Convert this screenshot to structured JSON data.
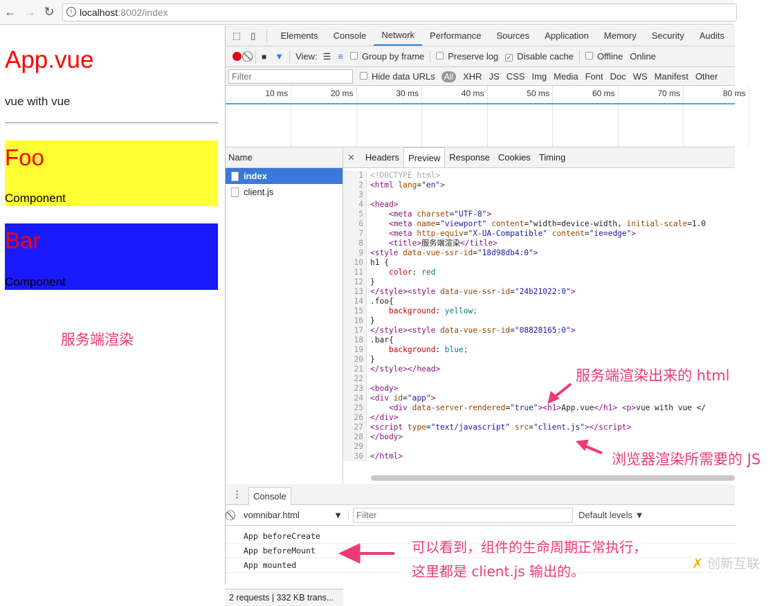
{
  "browser": {
    "url_host": "localhost",
    "url_path": ":8002/index"
  },
  "page": {
    "title": "App.vue",
    "text": "vue with vue",
    "foo": {
      "heading": "Foo",
      "text": "Component"
    },
    "bar": {
      "heading": "Bar",
      "text": "Component"
    },
    "annotation": "服务端渲染"
  },
  "devtools": {
    "tabs": [
      "Elements",
      "Console",
      "Network",
      "Performance",
      "Sources",
      "Application",
      "Memory",
      "Security",
      "Audits"
    ],
    "active_tab": "Network",
    "toolbar": {
      "view_label": "View:",
      "group_by_frame": "Group by frame",
      "preserve_log": "Preserve log",
      "disable_cache": "Disable cache",
      "disable_cache_checked": true,
      "offline": "Offline",
      "online": "Online"
    },
    "filter": {
      "placeholder": "Filter",
      "hide_data_urls": "Hide data URLs",
      "types": [
        "All",
        "XHR",
        "JS",
        "CSS",
        "Img",
        "Media",
        "Font",
        "Doc",
        "WS",
        "Manifest",
        "Other"
      ]
    },
    "timeline_ticks": [
      "10 ms",
      "20 ms",
      "30 ms",
      "40 ms",
      "50 ms",
      "60 ms",
      "70 ms",
      "80 ms"
    ],
    "name_header": "Name",
    "requests": [
      "index",
      "client.js"
    ],
    "status": "2 requests | 332 KB trans...",
    "preview_tabs": [
      "Headers",
      "Preview",
      "Response",
      "Cookies",
      "Timing"
    ],
    "active_preview_tab": "Preview",
    "code": [
      "<!DOCTYPE html>",
      "<html lang=\"en\">",
      "",
      "<head>",
      "    <meta charset=\"UTF-8\">",
      "    <meta name=\"viewport\" content=\"width=device-width, initial-scale=1.0",
      "    <meta http-equiv=\"X-UA-Compatible\" content=\"ie=edge\">",
      "    <title>服务端渲染</title>",
      "<style data-vue-ssr-id=\"18d98db4:0\">",
      "h1 {",
      "    color: red",
      "}",
      "</style><style data-vue-ssr-id=\"24b21022:0\">",
      ".foo{",
      "    background: yellow;",
      "}",
      "</style><style data-vue-ssr-id=\"08828165:0\">",
      ".bar{",
      "    background: blue;",
      "}",
      "</style></head>",
      "",
      "<body>",
      "<div id=\"app\">",
      "    <div data-server-rendered=\"true\"><h1>App.vue</h1> <p>vue with vue </",
      "</div>",
      "<script type=\"text/javascript\" src=\"client.js\"></script>",
      "</body>",
      "",
      "</html>"
    ],
    "drawer_tab": "Console",
    "console": {
      "context": "vomnibar.html",
      "filter_placeholder": "Filter",
      "levels": "Default levels ▼",
      "logs": [
        "App beforeCreate",
        "App beforeMount",
        "App mounted"
      ]
    }
  },
  "annotations": {
    "html": "服务端渲染出来的 html",
    "js": "浏览器渲染所需要的 JS",
    "console_1": "可以看到，组件的生命周期正常执行，",
    "console_2": "这里都是 client.js 输出的。",
    "accent": "#ee3a78"
  },
  "watermark": "创新互联"
}
